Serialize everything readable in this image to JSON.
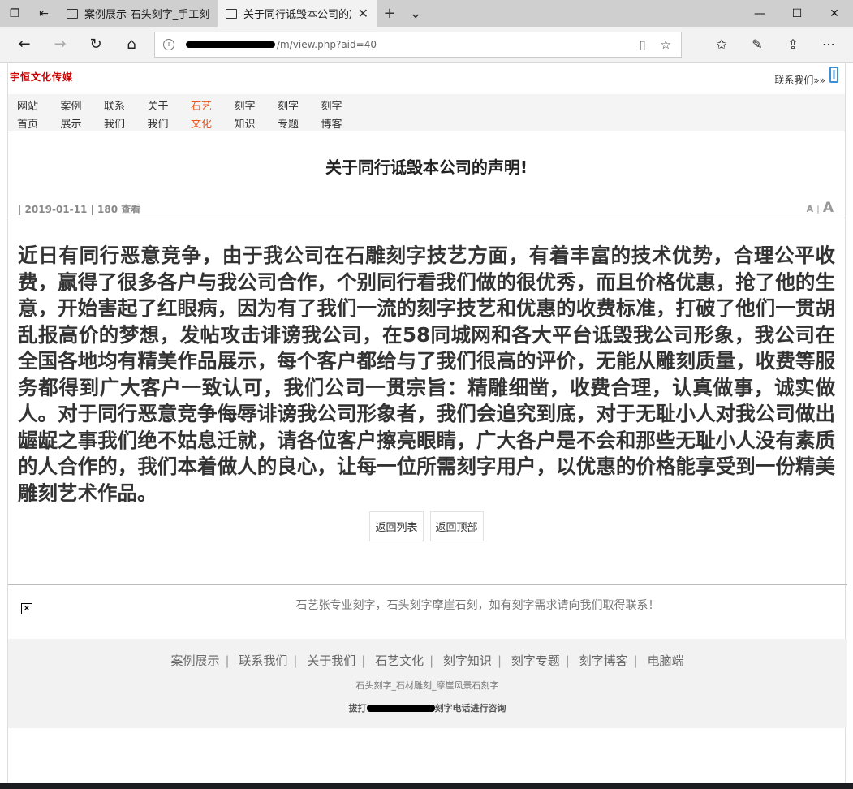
{
  "browser": {
    "tabs": [
      {
        "title": "案例展示-石头刻字_手工刻字",
        "active": false
      },
      {
        "title": "关于同行诋毁本公司的声明",
        "active": true
      }
    ],
    "url_visible": "/m/view.php?aid=40",
    "window_controls": [
      "minimize",
      "maximize",
      "close"
    ]
  },
  "site": {
    "logo": "宇恒文化传媒",
    "contact_link": "联系我们»»",
    "nav": [
      {
        "line1": "网站",
        "line2": "首页",
        "active": false
      },
      {
        "line1": "案例",
        "line2": "展示",
        "active": false
      },
      {
        "line1": "联系",
        "line2": "我们",
        "active": false
      },
      {
        "line1": "关于",
        "line2": "我们",
        "active": false
      },
      {
        "line1": "石艺",
        "line2": "文化",
        "active": true
      },
      {
        "line1": "刻字",
        "line2": "知识",
        "active": false
      },
      {
        "line1": "刻字",
        "line2": "专题",
        "active": false
      },
      {
        "line1": "刻字",
        "line2": "博客",
        "active": false
      }
    ]
  },
  "article": {
    "title": "关于同行诋毁本公司的声明!",
    "meta": "| 2019-01-11 | 180 查看",
    "font_small": "A",
    "font_sep": "|",
    "font_big": "A",
    "body": "近日有同行恶意竞争，由于我公司在石雕刻字技艺方面，有着丰富的技术优势，合理公平收费，赢得了很多各户与我公司合作，个别同行看我们做的很优秀，而且价格优惠，抢了他的生意，开始害起了红眼病，因为有了我们一流的刻字技艺和优惠的收费标准，打破了他们一贯胡乱报高价的梦想，发帖攻击诽谤我公司，在58同城网和各大平台诋毁我公司形象，我公司在全国各地均有精美作品展示，每个客户都给与了我们很高的评价，无能从雕刻质量，收费等服务都得到广大客户一致认可，我们公司一贯宗旨：精雕细凿，收费合理，认真做事，诚实做人。对于同行恶意竞争侮辱诽谤我公司形象者，我们会追究到底，对于无耻小人对我公司做出龌龊之事我们绝不姑息迁就，请各位客户擦亮眼睛，广大各户是不会和那些无耻小人没有素质的人合作的，我们本着做人的良心，让每一位所需刻字用户，以优惠的价格能享受到一份精美雕刻艺术作品。",
    "back_to_list": "返回列表",
    "back_to_top": "返回顶部"
  },
  "notice": "石艺张专业刻字，石头刻字摩崖石刻，如有刻字需求请向我们取得联系！",
  "footer": {
    "links": [
      "案例展示",
      "联系我们",
      "关于我们",
      "石艺文化",
      "刻字知识",
      "刻字专题",
      "刻字博客",
      "电脑端"
    ],
    "link_sep": "|",
    "subtitle": "石头刻字_石材雕刻_摩崖风景石刻字",
    "phone_prefix": "拔打",
    "phone_suffix": "刻字电话进行咨询"
  }
}
